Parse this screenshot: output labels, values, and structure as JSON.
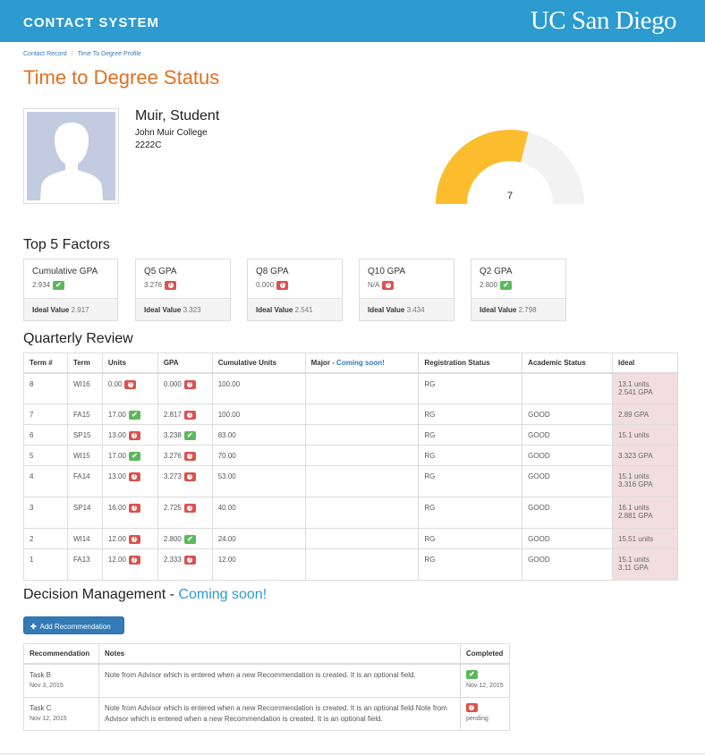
{
  "header": {
    "app_title": "CONTACT SYSTEM",
    "logo_text": "UC San Diego"
  },
  "breadcrumb": [
    "Contact Record",
    "Time To Degree Profile"
  ],
  "page_title": "Time to Degree Status",
  "student": {
    "name": "Muir, Student",
    "college": "John Muir College",
    "id": "2222C"
  },
  "gauge": {
    "value": "7",
    "fill_fraction": 0.58,
    "fill_color": "#fbbd2e",
    "track_color": "#f2f2f2"
  },
  "factors": {
    "title": "Top 5 Factors",
    "ideal_label": "Ideal Value",
    "items": [
      {
        "label": "Cumulative GPA",
        "value": "2.934",
        "status": "ok",
        "ideal": "2.917"
      },
      {
        "label": "Q5 GPA",
        "value": "3.276",
        "status": "bad",
        "ideal": "3.323"
      },
      {
        "label": "Q8 GPA",
        "value": "0.000",
        "status": "bad",
        "ideal": "2.541"
      },
      {
        "label": "Q10 GPA",
        "value": "N/A",
        "status": "bad",
        "ideal": "3.434"
      },
      {
        "label": "Q2 GPA",
        "value": "2.800",
        "status": "ok",
        "ideal": "2.798"
      }
    ]
  },
  "quarterly": {
    "title": "Quarterly Review",
    "headers": {
      "term_num": "Term #",
      "term": "Term",
      "units": "Units",
      "gpa": "GPA",
      "cum_units": "Cumulative Units",
      "major": "Major - ",
      "major_coming": "Coming soon!",
      "reg": "Registration Status",
      "acad": "Academic Status",
      "ideal": "Ideal"
    },
    "rows": [
      {
        "num": "8",
        "term": "WI16",
        "units": "0.00",
        "units_status": "bad",
        "gpa": "0.000",
        "gpa_status": "bad",
        "cum": "100.00",
        "reg": "RG",
        "acad": "",
        "ideal": [
          "13.1 units",
          "2.541 GPA"
        ]
      },
      {
        "num": "7",
        "term": "FA15",
        "units": "17.00",
        "units_status": "ok",
        "gpa": "2.817",
        "gpa_status": "bad",
        "cum": "100.00",
        "reg": "RG",
        "acad": "GOOD",
        "ideal": [
          "2.89 GPA"
        ]
      },
      {
        "num": "6",
        "term": "SP15",
        "units": "13.00",
        "units_status": "bad",
        "gpa": "3.238",
        "gpa_status": "ok",
        "cum": "83.00",
        "reg": "RG",
        "acad": "GOOD",
        "ideal": [
          "15.1 units"
        ]
      },
      {
        "num": "5",
        "term": "WI15",
        "units": "17.00",
        "units_status": "ok",
        "gpa": "3.276",
        "gpa_status": "bad",
        "cum": "70.00",
        "reg": "RG",
        "acad": "GOOD",
        "ideal": [
          "3.323 GPA"
        ]
      },
      {
        "num": "4",
        "term": "FA14",
        "units": "13.00",
        "units_status": "bad",
        "gpa": "3.273",
        "gpa_status": "bad",
        "cum": "53.00",
        "reg": "RG",
        "acad": "GOOD",
        "ideal": [
          "15.1 units",
          "3.316 GPA"
        ]
      },
      {
        "num": "3",
        "term": "SP14",
        "units": "16.00",
        "units_status": "bad",
        "gpa": "2.725",
        "gpa_status": "bad",
        "cum": "40.00",
        "reg": "RG",
        "acad": "GOOD",
        "ideal": [
          "16.1 units",
          "2.881 GPA"
        ]
      },
      {
        "num": "2",
        "term": "WI14",
        "units": "12.00",
        "units_status": "bad",
        "gpa": "2.800",
        "gpa_status": "ok",
        "cum": "24.00",
        "reg": "RG",
        "acad": "GOOD",
        "ideal": [
          "15.51 units"
        ]
      },
      {
        "num": "1",
        "term": "FA13",
        "units": "12.00",
        "units_status": "bad",
        "gpa": "2.333",
        "gpa_status": "bad",
        "cum": "12.00",
        "reg": "RG",
        "acad": "GOOD",
        "ideal": [
          "15.1 units",
          "3.11 GPA"
        ]
      }
    ]
  },
  "decision": {
    "title": "Decision Management - ",
    "coming": "Coming soon!",
    "add_button": "Add Recommendation",
    "headers": {
      "rec": "Recommendation",
      "notes": "Notes",
      "completed": "Completed"
    },
    "rows": [
      {
        "task": "Task B",
        "date": "Nov 3, 2015",
        "notes": "Note from Advisor which is entered when a new Recommendation is created. It is an optional field.",
        "status": "ok",
        "completed": "Nov 12, 2015"
      },
      {
        "task": "Task C",
        "date": "Nov 12, 2015",
        "notes": "Note from Advisor which is entered when a new Recommendation is created. It is an optional field Note from Advisor which is entered when a new Recommendation is created. It is an optional field.",
        "status": "bad",
        "completed": "pending"
      }
    ]
  }
}
